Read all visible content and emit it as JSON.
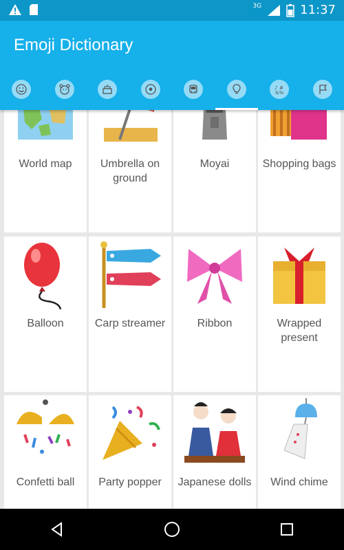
{
  "status_bar": {
    "time": "11:37",
    "network": "3G"
  },
  "app": {
    "title": "Emoji Dictionary"
  },
  "tabs": [
    {
      "icon": "smiley-icon"
    },
    {
      "icon": "animal-icon"
    },
    {
      "icon": "food-icon"
    },
    {
      "icon": "sports-ball-icon"
    },
    {
      "icon": "vehicle-icon"
    },
    {
      "icon": "lightbulb-icon",
      "active": true
    },
    {
      "icon": "symbols-icon"
    },
    {
      "icon": "flag-icon"
    }
  ],
  "emojis": [
    {
      "name": "World map"
    },
    {
      "name": "Umbrella on ground"
    },
    {
      "name": "Moyai"
    },
    {
      "name": "Shopping bags"
    },
    {
      "name": "Balloon"
    },
    {
      "name": "Carp streamer"
    },
    {
      "name": "Ribbon"
    },
    {
      "name": "Wrapped present"
    },
    {
      "name": "Confetti ball"
    },
    {
      "name": "Party popper"
    },
    {
      "name": "Japanese dolls"
    },
    {
      "name": "Wind chime"
    }
  ],
  "colors": {
    "status_bar": "#0d96c8",
    "app_bar": "#16b0ea"
  }
}
